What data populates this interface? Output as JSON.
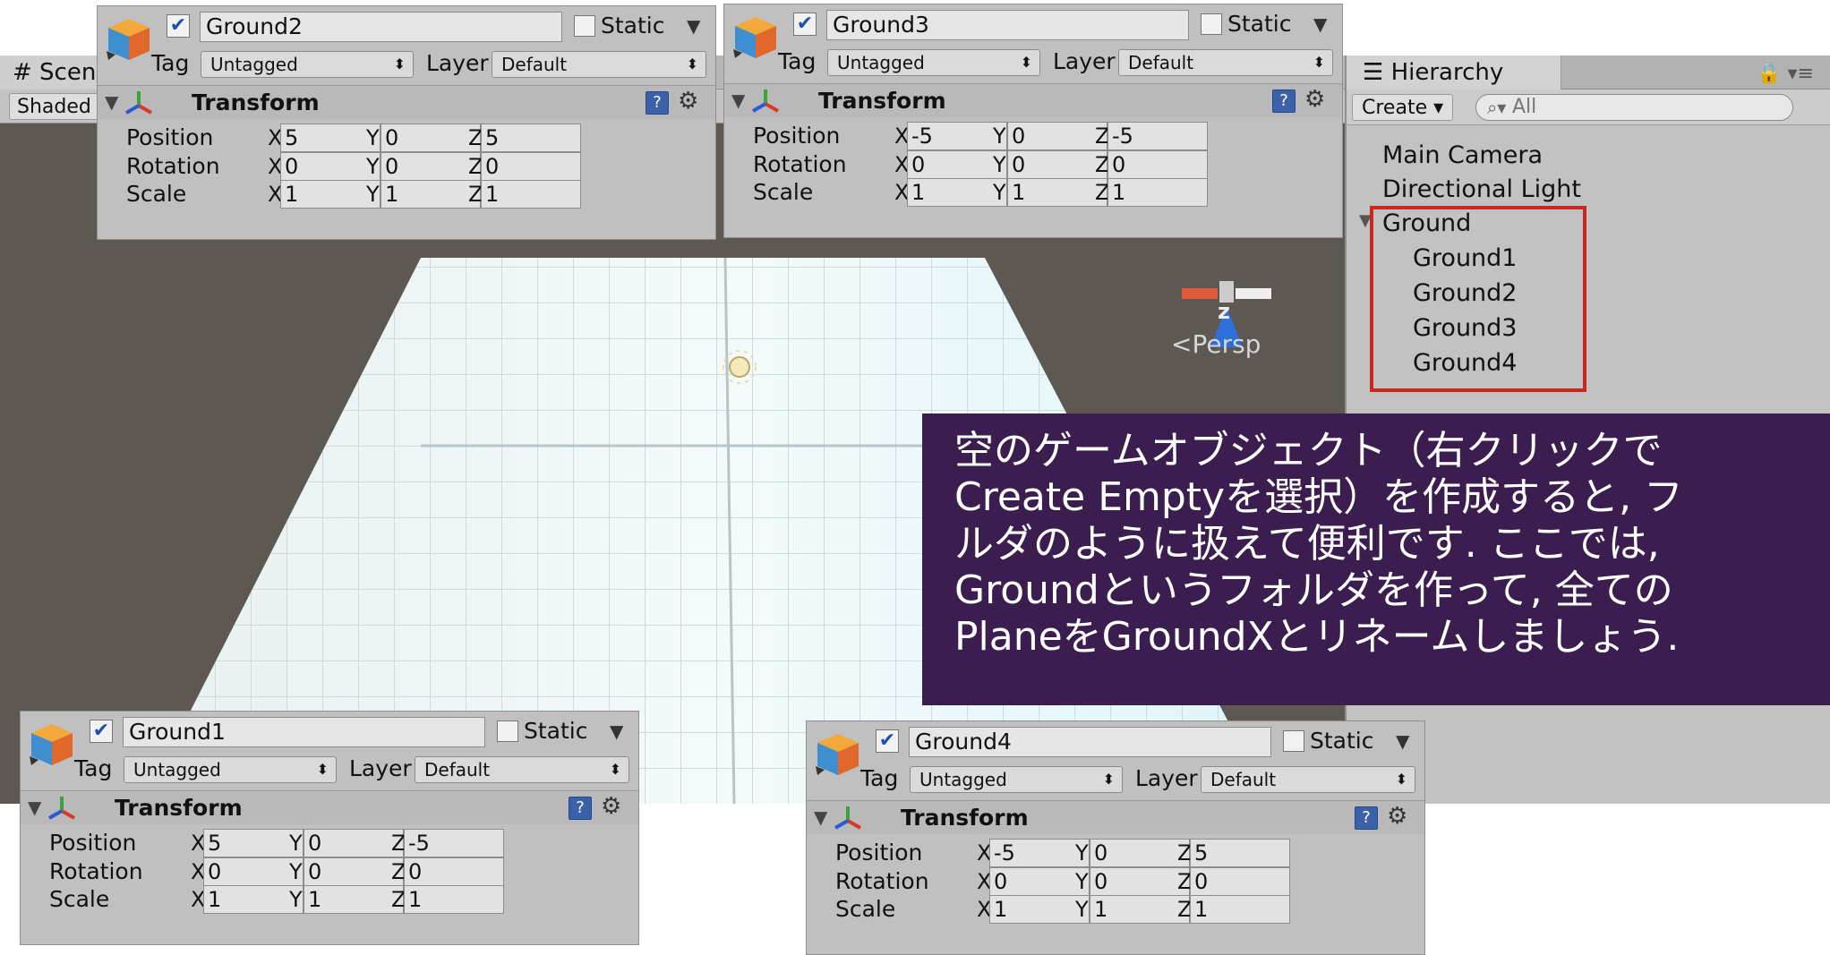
{
  "scene": {
    "tab_label": "# Scen",
    "shading_mode": "Shaded",
    "gizmo_axis": "z",
    "projection_label": "<Persp"
  },
  "hierarchy": {
    "tab_label": "Hierarchy",
    "create_label": "Create",
    "search_placeholder": "All",
    "items": [
      "Main Camera",
      "Directional Light",
      "Ground",
      "Ground1",
      "Ground2",
      "Ground3",
      "Ground4"
    ]
  },
  "callout": {
    "lines": [
      "空のゲームオブジェクト（右クリックで",
      "Create Emptyを選択）を作成すると, フ",
      "ルダのように扱えて便利です. ここでは,",
      "Groundというフォルダを作って, 全ての",
      "PlaneをGroundXとリネームしましょう."
    ]
  },
  "inspector_labels": {
    "static": "Static",
    "tag": "Tag",
    "layer": "Layer",
    "component": "Transform",
    "position": "Position",
    "rotation": "Rotation",
    "scale": "Scale",
    "x": "X",
    "y": "Y",
    "z": "Z"
  },
  "inspectors": [
    {
      "name": "Ground2",
      "tag": "Untagged",
      "layer": "Default",
      "position": {
        "x": "5",
        "y": "0",
        "z": "5"
      },
      "rotation": {
        "x": "0",
        "y": "0",
        "z": "0"
      },
      "scale": {
        "x": "1",
        "y": "1",
        "z": "1"
      }
    },
    {
      "name": "Ground3",
      "tag": "Untagged",
      "layer": "Default",
      "position": {
        "x": "-5",
        "y": "0",
        "z": "-5"
      },
      "rotation": {
        "x": "0",
        "y": "0",
        "z": "0"
      },
      "scale": {
        "x": "1",
        "y": "1",
        "z": "1"
      }
    },
    {
      "name": "Ground1",
      "tag": "Untagged",
      "layer": "Default",
      "position": {
        "x": "5",
        "y": "0",
        "z": "-5"
      },
      "rotation": {
        "x": "0",
        "y": "0",
        "z": "0"
      },
      "scale": {
        "x": "1",
        "y": "1",
        "z": "1"
      }
    },
    {
      "name": "Ground4",
      "tag": "Untagged",
      "layer": "Default",
      "position": {
        "x": "-5",
        "y": "0",
        "z": "5"
      },
      "rotation": {
        "x": "0",
        "y": "0",
        "z": "0"
      },
      "scale": {
        "x": "1",
        "y": "1",
        "z": "1"
      }
    }
  ]
}
